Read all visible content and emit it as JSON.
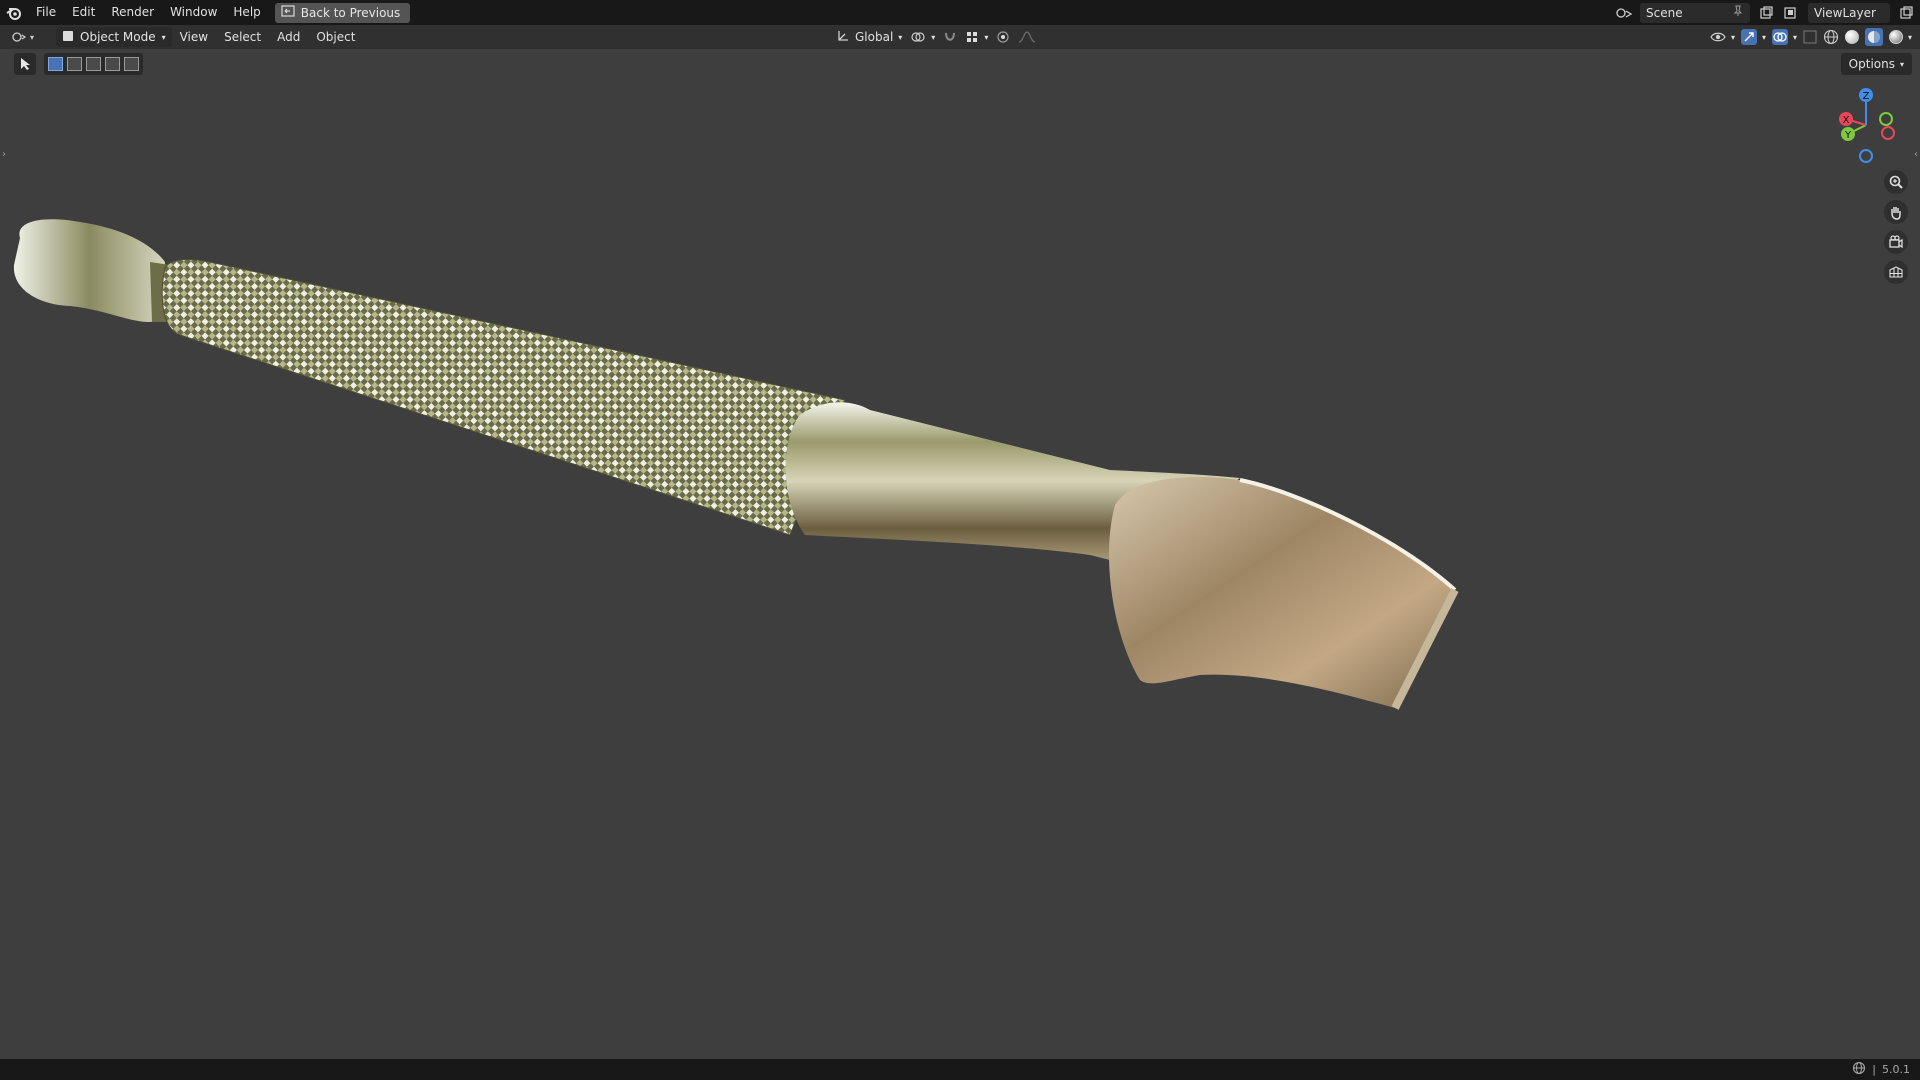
{
  "topbar": {
    "menus": [
      "File",
      "Edit",
      "Render",
      "Window",
      "Help"
    ],
    "back_button": "Back to Previous",
    "scene": "Scene",
    "view_layer": "ViewLayer"
  },
  "viewport_header": {
    "mode": "Object Mode",
    "menus": [
      "View",
      "Select",
      "Add",
      "Object"
    ],
    "orientation": "Global"
  },
  "options_label": "Options",
  "status": {
    "version": "5.0.1"
  },
  "colors": {
    "accent": "#4772b3",
    "axis_x": "#e8465a",
    "axis_y": "#7ec93c",
    "axis_z": "#3f8ee8"
  },
  "icons": [
    "blender-logo-icon",
    "back-icon",
    "scene-icon",
    "pin-icon",
    "new-scene-icon",
    "view-layer-icon",
    "editor-type-icon",
    "object-mode-icon",
    "transform-pivot-icon",
    "snap-icon",
    "proportional-edit-icon",
    "visibility-icon",
    "gizmo-icon",
    "overlay-icon",
    "xray-icon",
    "wireframe-shading-icon",
    "solid-shading-icon",
    "material-shading-icon",
    "rendered-shading-icon",
    "select-box-icon",
    "zoom-icon",
    "pan-hand-icon",
    "camera-view-icon",
    "ortho-grid-icon",
    "network-icon"
  ]
}
